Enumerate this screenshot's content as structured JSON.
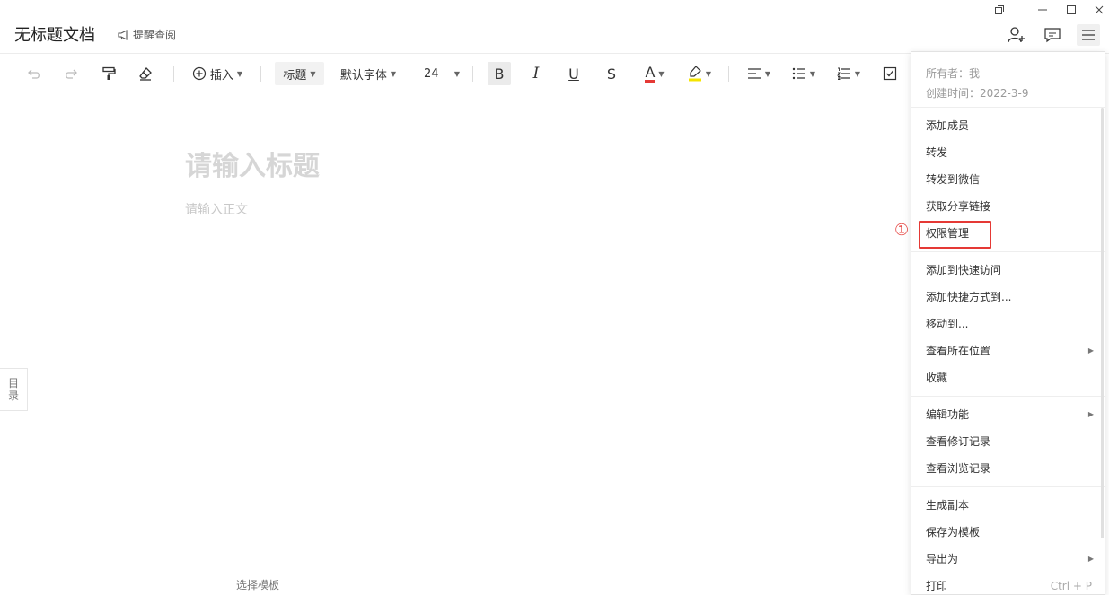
{
  "header": {
    "doc_title": "无标题文档",
    "remind_label": "提醒查阅"
  },
  "toolbar": {
    "insert_label": "插入",
    "heading_style": "标题",
    "font_family": "默认字体",
    "font_size": "24",
    "bold_label": "B",
    "italic_label": "I",
    "underline_label": "U",
    "strike_label": "S",
    "font_color_label": "A",
    "font_color": "#e53935",
    "highlight_color": "#f5e400"
  },
  "editor": {
    "title_placeholder": "请输入标题",
    "body_placeholder": "请输入正文",
    "toc_label_1": "目",
    "toc_label_2": "录",
    "template_link": "选择模板"
  },
  "menu": {
    "owner": "所有者：我",
    "created": "创建时间：2022-3-9",
    "sections": [
      [
        {
          "label": "添加成员"
        },
        {
          "label": "转发"
        },
        {
          "label": "转发到微信"
        },
        {
          "label": "获取分享链接"
        },
        {
          "label": "权限管理",
          "highlighted": true
        }
      ],
      [
        {
          "label": "添加到快速访问"
        },
        {
          "label": "添加快捷方式到..."
        },
        {
          "label": "移动到..."
        },
        {
          "label": "查看所在位置",
          "submenu": true
        },
        {
          "label": "收藏"
        }
      ],
      [
        {
          "label": "编辑功能",
          "submenu": true
        },
        {
          "label": "查看修订记录"
        },
        {
          "label": "查看浏览记录"
        }
      ],
      [
        {
          "label": "生成副本"
        },
        {
          "label": "保存为模板"
        },
        {
          "label": "导出为",
          "submenu": true
        },
        {
          "label": "打印",
          "shortcut": "Ctrl + P"
        }
      ]
    ]
  },
  "annotation": {
    "marker": "①",
    "color": "#e53935"
  }
}
